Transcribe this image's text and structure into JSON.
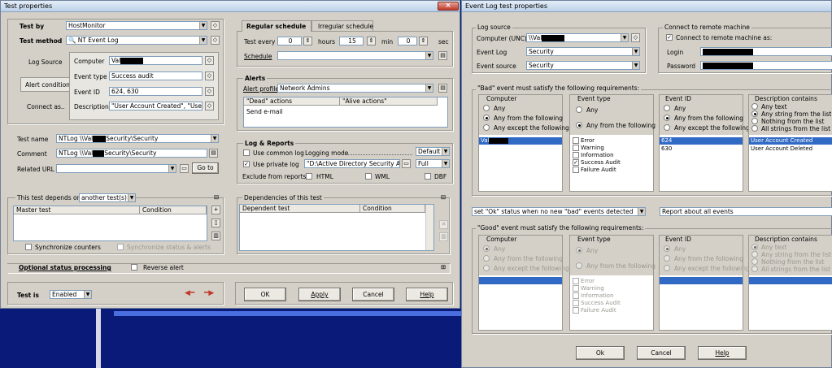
{
  "left_window": {
    "title": "Test properties",
    "test_by": {
      "label": "Test by",
      "value": "HostMonitor"
    },
    "test_method": {
      "label": "Test method",
      "value": "NT Event Log"
    },
    "tabs": [
      "Log Source",
      "Alert condition",
      "Connect as.."
    ],
    "fields": {
      "computer": {
        "label": "Computer",
        "value": "Val"
      },
      "event_type": {
        "label": "Event type",
        "value": "Success audit"
      },
      "event_id": {
        "label": "Event ID",
        "value": "624, 630"
      },
      "description": {
        "label": "Description",
        "value": "\"User Account Created\", \"User A"
      }
    },
    "test_name": {
      "label": "Test name",
      "value_a": "NTLog \\\\Val",
      "value_b": "Security\\Security"
    },
    "comment": {
      "label": "Comment",
      "value_a": "NTLog \\\\Val",
      "value_b": "Security\\Security"
    },
    "related_url": {
      "label": "Related URL",
      "value": "",
      "goto": "Go to"
    },
    "depends": {
      "label": "This test depends on",
      "value": "another test(s)",
      "col_master": "Master test",
      "col_condition": "Condition",
      "sync_counters": "Synchronize counters",
      "sync_status": "Synchronize status & alerts"
    },
    "dependencies": {
      "label": "Dependencies of this test",
      "col_dependent": "Dependent test",
      "col_condition": "Condition"
    },
    "optional": {
      "label": "Optional status processing",
      "reverse": "Reverse alert"
    },
    "test_is": {
      "label": "Test is",
      "value": "Enabled"
    },
    "schedule": {
      "tab_regular": "Regular schedule",
      "tab_irregular": "Irregular schedule",
      "test_every": "Test every",
      "days_val": "0",
      "hours_label": "hours",
      "hours_val": "15",
      "min_label": "min",
      "min_val": "0",
      "sec_label": "sec",
      "schedule_label": "Schedule",
      "schedule_val": ""
    },
    "alerts": {
      "label": "Alerts",
      "profile_label": "Alert profile",
      "profile_val": "Network Admins",
      "dead": "\"Dead\" actions",
      "alive": "\"Alive actions\"",
      "action1": "Send e-mail"
    },
    "log": {
      "label": "Log & Reports",
      "use_common": "Use common log",
      "logging_mode": "Logging mode",
      "mode_default": "Default",
      "use_private": "Use private log",
      "private_path": "\"D:\\Active Directory Security Aud",
      "mode_full": "Full",
      "exclude": "Exclude from reports:",
      "html": "HTML",
      "wml": "WML",
      "dbf": "DBF"
    },
    "buttons": {
      "ok": "OK",
      "apply": "Apply",
      "cancel": "Cancel",
      "help": "Help"
    }
  },
  "right_window": {
    "title": "Event Log test properties",
    "log_source": {
      "label": "Log source",
      "computer_label": "Computer (UNC)",
      "computer_val": "\\\\Val",
      "log_label": "Event Log",
      "log_val": "Security",
      "source_label": "Event source",
      "source_val": "Security"
    },
    "remote": {
      "label": "Connect to remote machine",
      "connect_as": "Connect to remote machine as:",
      "login": "Login",
      "password": "Password"
    },
    "bad": {
      "label": "\"Bad\" event must satisfy the following requirements:",
      "computer": {
        "label": "Computer",
        "opts": [
          "Any",
          "Any from the following",
          "Any except the following"
        ],
        "items": [
          "Val"
        ]
      },
      "event_type": {
        "label": "Event type",
        "opts": [
          "Any",
          "Any from the following"
        ],
        "items": [
          "Error",
          "Warning",
          "Information",
          "Success Audit",
          "Failure Audit"
        ]
      },
      "event_id": {
        "label": "Event ID",
        "opts": [
          "Any",
          "Any from the following",
          "Any except the following"
        ],
        "items": [
          "624",
          "630"
        ]
      },
      "desc": {
        "label": "Description contains",
        "opts": [
          "Any text",
          "Any string from the list",
          "Nothing from the list",
          "All strings from the list"
        ],
        "items": [
          "User Account Created",
          "User Account Deleted"
        ]
      }
    },
    "ok_status": {
      "value": "set \"Ok\" status when no new \"bad\" events detected",
      "report": "Report about all events"
    },
    "good": {
      "label": "\"Good\" event must satisfy the following requirements:",
      "computer": {
        "label": "Computer",
        "opts": [
          "Any",
          "Any from the following",
          "Any except the following"
        ]
      },
      "event_type": {
        "label": "Event type",
        "opts": [
          "Any",
          "Any from the following"
        ],
        "items": [
          "Error",
          "Warning",
          "Information",
          "Success Audit",
          "Failure Audit"
        ]
      },
      "event_id": {
        "label": "Event ID",
        "opts": [
          "Any",
          "Any from the following",
          "Any except the following"
        ]
      },
      "desc": {
        "label": "Description contains",
        "opts": [
          "Any text",
          "Any string from the list",
          "Nothing from the list",
          "All strings from the list"
        ]
      }
    },
    "buttons": {
      "ok": "Ok",
      "cancel": "Cancel",
      "help": "Help"
    }
  }
}
